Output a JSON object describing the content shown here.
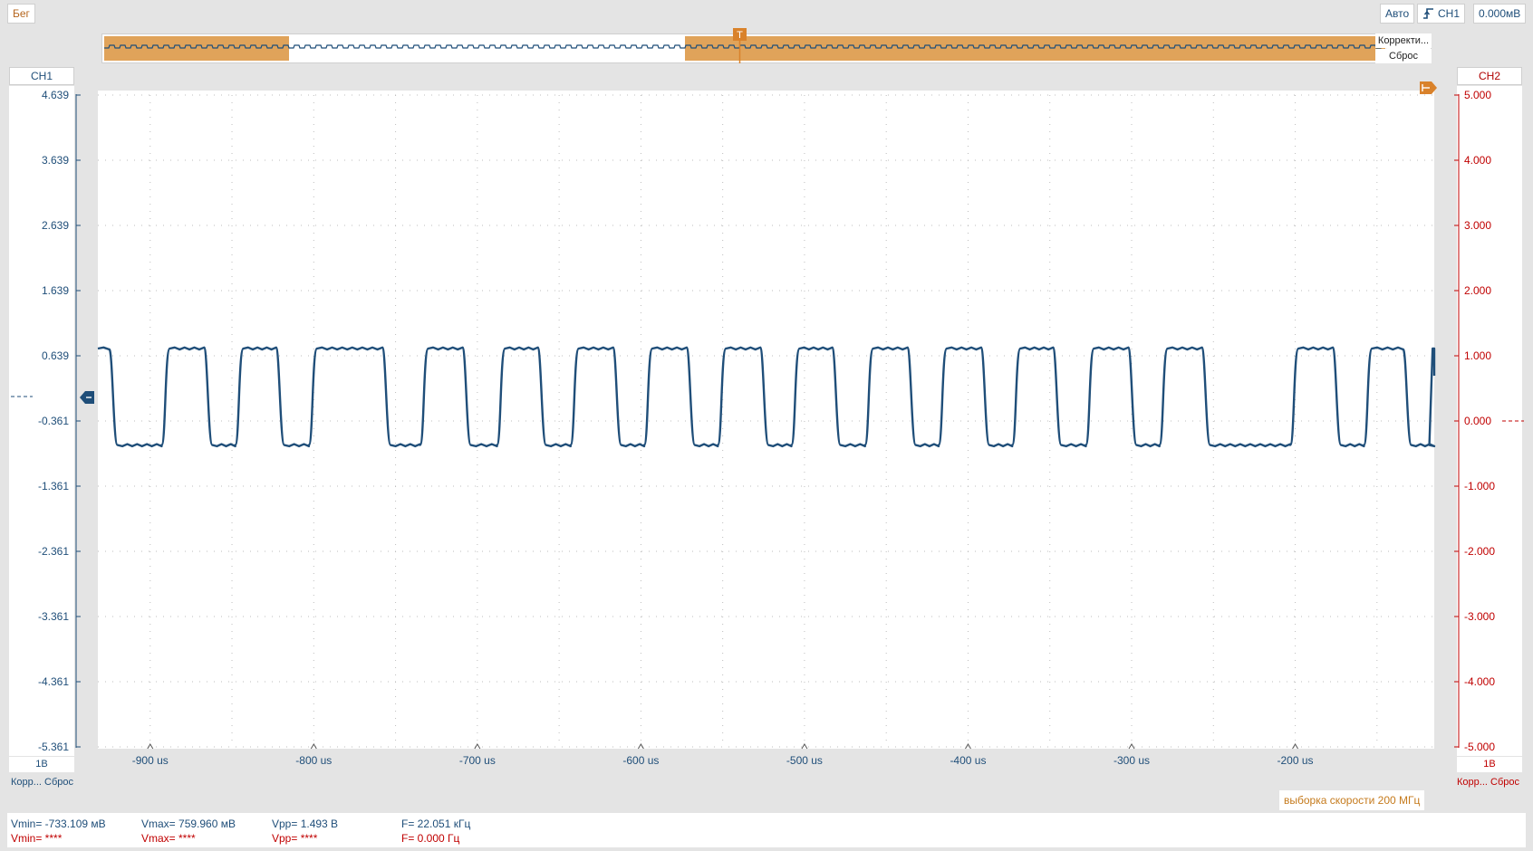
{
  "toolbar": {
    "run_label": "Бег",
    "mode_label": "Авто",
    "trigger_source": "CH1",
    "trigger_level": "0.000мВ"
  },
  "overview": {
    "correct_label": "Корректи...",
    "reset_label": "Сброс",
    "trigger_marker": "T"
  },
  "ch1": {
    "header": "CH1",
    "scale": "1В",
    "correct_label": "Корр...",
    "reset_label": "Сброс",
    "ticks": [
      "4.639",
      "3.639",
      "2.639",
      "1.639",
      "0.639",
      "-0.361",
      "-1.361",
      "-2.361",
      "-3.361",
      "-4.361",
      "-5.361"
    ]
  },
  "ch2": {
    "header": "CH2",
    "scale": "1В",
    "correct_label": "Корр...",
    "reset_label": "Сброс",
    "ticks": [
      "5.000",
      "4.000",
      "3.000",
      "2.000",
      "1.000",
      "0.000",
      "-1.000",
      "-2.000",
      "-3.000",
      "-4.000",
      "-5.000"
    ]
  },
  "xaxis": {
    "ticks": [
      "-900 us",
      "-800 us",
      "-700 us",
      "-600 us",
      "-500 us",
      "-400 us",
      "-300 us",
      "-200 us"
    ]
  },
  "sample_rate": "выборка скорости 200 МГц",
  "measurements": {
    "ch1": {
      "vmin": "Vmin= -733.109 мВ",
      "vmax": "Vmax= 759.960 мВ",
      "vpp": "Vpp= 1.493 В",
      "freq": "F= 22.051 кГц"
    },
    "ch2": {
      "vmin": "Vmin= ****",
      "vmax": "Vmax= ****",
      "vpp": "Vpp= ****",
      "freq": "F= 0.000 Гц"
    }
  },
  "colors": {
    "ch1": "#1f4e79",
    "ch2": "#c00000",
    "accent": "#c57a1c",
    "overview_fill": "#e0a35a"
  },
  "chart_data": {
    "type": "line",
    "x_unit": "us",
    "xlim": [
      -932,
      -115
    ],
    "ylim": [
      -5.361,
      4.639
    ],
    "y_high": 0.75,
    "y_low": -0.73,
    "series": [
      {
        "name": "CH1",
        "high_intervals_us": [
          [
            -932,
            -925
          ],
          [
            -888,
            -867
          ],
          [
            -843,
            -823
          ],
          [
            -798,
            -758
          ],
          [
            -730,
            -709
          ],
          [
            -683,
            -663
          ],
          [
            -638,
            -617
          ],
          [
            -593,
            -572
          ],
          [
            -548,
            -527
          ],
          [
            -503,
            -483
          ],
          [
            -458,
            -437
          ],
          [
            -413,
            -392
          ],
          [
            -368,
            -348
          ],
          [
            -323,
            -302
          ],
          [
            -278,
            -257
          ],
          [
            -198,
            -177
          ],
          [
            -153,
            -134
          ]
        ]
      }
    ]
  }
}
